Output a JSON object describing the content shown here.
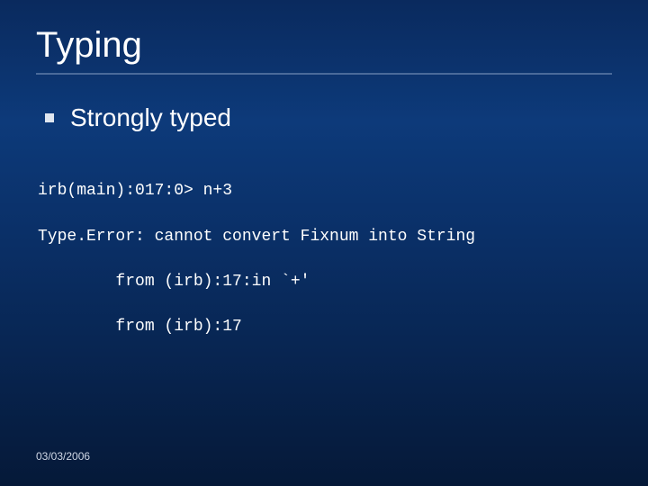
{
  "title": "Typing",
  "bullet": {
    "text": "Strongly typed"
  },
  "code": {
    "line1": "irb(main):017:0> n+3",
    "line2": "Type.Error: cannot convert Fixnum into String",
    "line3": "        from (irb):17:in `+'",
    "line4": "        from (irb):17"
  },
  "footer_date": "03/03/2006"
}
